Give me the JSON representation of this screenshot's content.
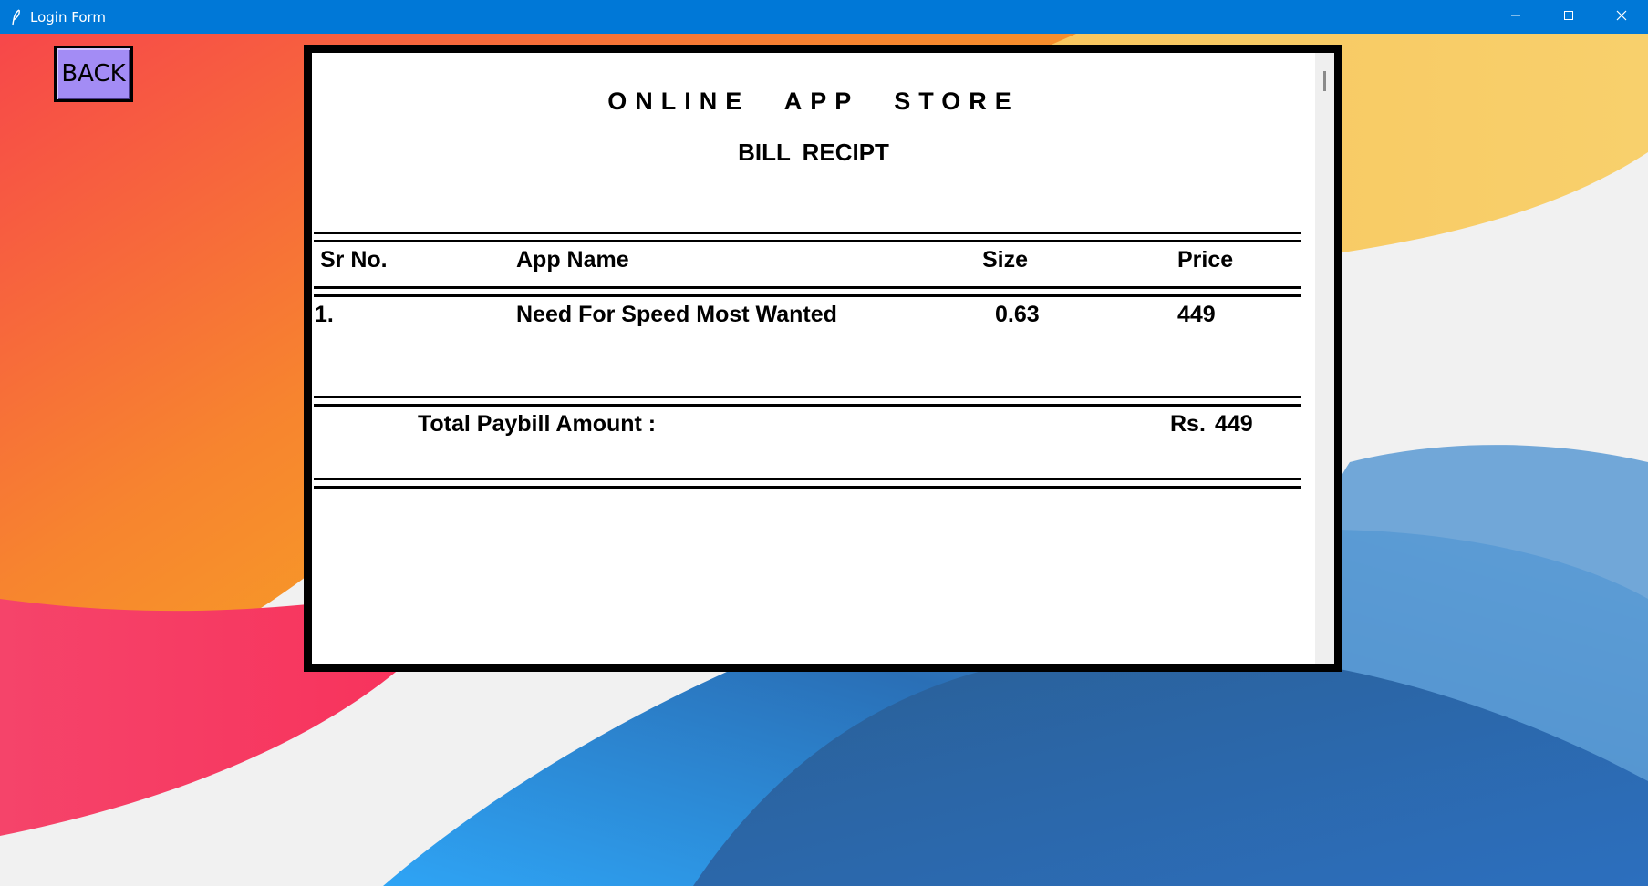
{
  "window": {
    "title": "Login Form",
    "controls": {
      "minimize": "minimize-icon",
      "maximize": "maximize-icon",
      "close": "close-icon"
    }
  },
  "back_button": {
    "label": "BACK"
  },
  "receipt": {
    "title": "ONLINE  APP  STORE",
    "subtitle": "BILL  RECIPT",
    "columns": {
      "sr_no": "Sr No.",
      "app_name": "App Name",
      "size": "Size",
      "price": "Price"
    },
    "items": [
      {
        "sr_no": "1.",
        "app_name": "Need For Speed Most Wanted",
        "size": "0.63",
        "price": "449"
      }
    ],
    "total": {
      "label": "Total Paybill Amount :",
      "currency": "Rs.",
      "amount": "449"
    }
  },
  "colors": {
    "titlebar": "#0078d7",
    "back_button": "#a38cf5",
    "wallpaper_orange": "#f5a623",
    "wallpaper_red": "#f53b5a",
    "wallpaper_yellow": "#f8cd62",
    "wallpaper_blue": "#2f7fcf"
  }
}
